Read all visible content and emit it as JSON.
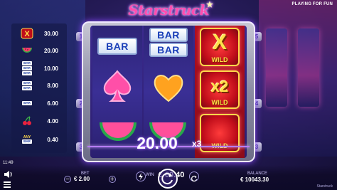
{
  "header": {
    "logo_text": "Starstruck",
    "playing_for_fun": "PLAYING FOR FUN"
  },
  "paytable": [
    {
      "icon": "x-wild-icon",
      "value": "30.00"
    },
    {
      "icon": "watermelon-icon",
      "value": "20.00"
    },
    {
      "icon": "triple-bar-icon",
      "value": "10.00"
    },
    {
      "icon": "double-bar-icon",
      "value": "8.00"
    },
    {
      "icon": "single-bar-icon",
      "value": "6.00"
    },
    {
      "icon": "cherry-icon",
      "value": "4.00"
    },
    {
      "icon": "any-bar-icon",
      "any_label": "ANY",
      "bar_label": "BAR",
      "value": "0.40"
    }
  ],
  "reels": {
    "bar_label": "BAR",
    "wild_label": "WILD",
    "x_label": "X",
    "x2_label": "x2"
  },
  "paylines": {
    "left": [
      "1",
      "2",
      "3"
    ],
    "right": [
      "5",
      "4",
      "3"
    ]
  },
  "win_overlay": {
    "amount": "20.00",
    "multiplier": "x3"
  },
  "win": {
    "label": "WIN",
    "value": "€ 60.40"
  },
  "status": {
    "time": "11:49"
  },
  "bet": {
    "label": "BET",
    "value": "€ 2.00",
    "minus": "−",
    "plus": "+"
  },
  "balance": {
    "label": "BALANCE",
    "value": "€ 10043.30"
  },
  "footer": {
    "game_name": "Starstruck"
  },
  "colors": {
    "accent": "#ff4fb0",
    "reel_bg": "#3a2f95",
    "wild_red": "#c00d1a",
    "gold": "#ffd84a"
  }
}
